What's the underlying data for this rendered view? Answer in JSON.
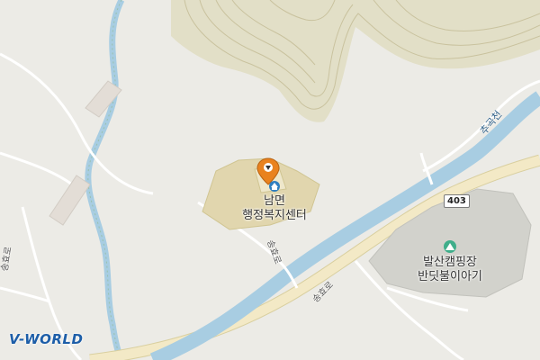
{
  "map": {
    "poi_main_line1": "남면",
    "poi_main_line2": "행정복지센터",
    "poi_camp_line1": "발산캠핑장",
    "poi_camp_line2": "반딧불이아기",
    "road_label_a": "송효로",
    "road_label_b": "송효로",
    "road_label_c": "송효로",
    "route_number": "403",
    "river_name": "추곡천",
    "logo_text": "V-WORLD"
  },
  "colors": {
    "background": "#ecebe6",
    "water": "#a8cde2",
    "road": "#ffffff",
    "road_major": "#f3e9c6",
    "hill": "#e2dfc7",
    "contour": "#c9c29e",
    "building": "#e1d6ae",
    "camp_area": "#d2d2cc",
    "marker": "#e9821e",
    "poi_icon": "#2f7fc0",
    "camp_icon": "#3fae8a",
    "logo": "#1d5ea8"
  },
  "icons": [
    "location-pin-icon",
    "government-office-icon",
    "campground-icon"
  ]
}
